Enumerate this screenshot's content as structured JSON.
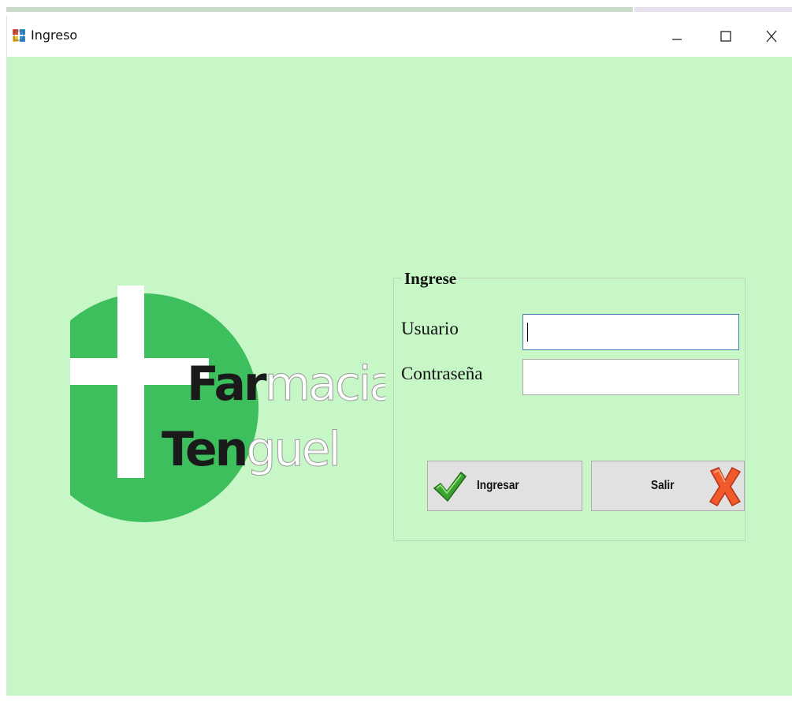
{
  "window": {
    "title": "Ingreso"
  },
  "logo": {
    "line1_bold": "Far",
    "line1_light": "macia",
    "line2_bold": "Ten",
    "line2_light": "guel",
    "circle_color": "#3cbf5c"
  },
  "login": {
    "group_title": "Ingrese",
    "usuario_label": "Usuario",
    "usuario_value": "",
    "password_label": "Contraseña",
    "password_value": "",
    "ingresar_label": "Ingresar",
    "salir_label": "Salir"
  },
  "colors": {
    "background": "#c7f7c6",
    "button_face": "#e1e1e1",
    "focus_border": "#3c7fb1"
  },
  "icons": {
    "app": "app-icon",
    "minimize": "minimize-icon",
    "maximize": "maximize-icon",
    "close": "close-icon",
    "ingresar": "check-icon",
    "salir": "x-icon"
  }
}
